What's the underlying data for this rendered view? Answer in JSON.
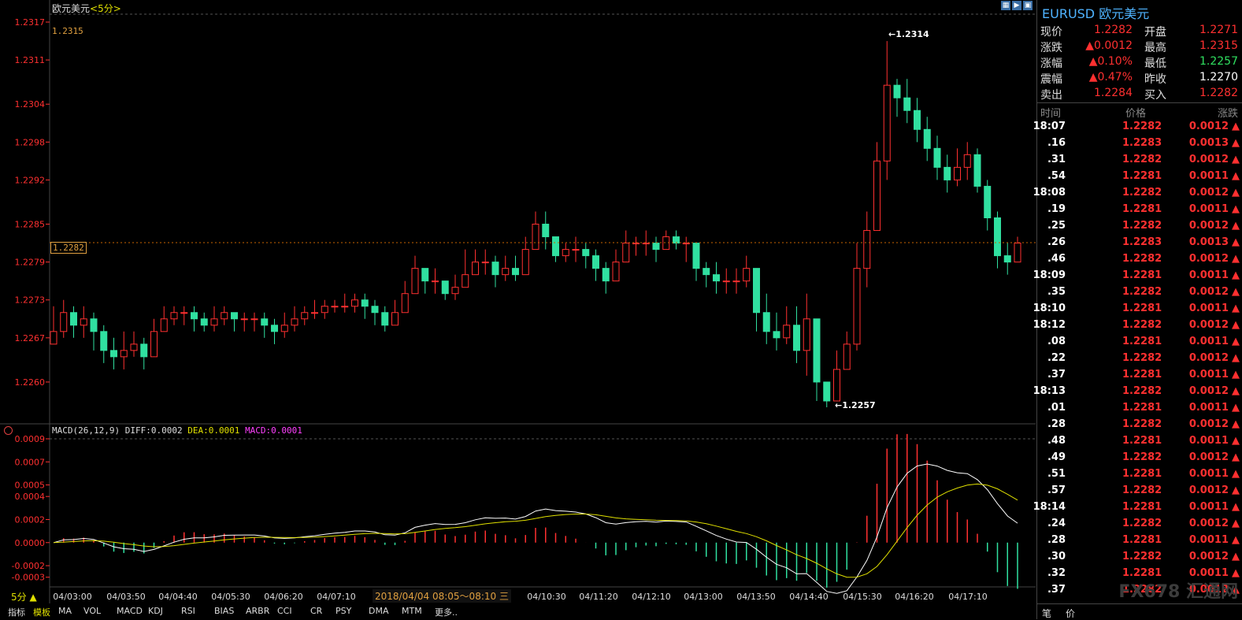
{
  "title": "欧元美元",
  "period_label": "<5分>",
  "top_value_label": "1.2315",
  "current_price_tag": "1.2282",
  "high_annotation": "1.2314",
  "low_annotation": "1.2257",
  "macd_label": "MACD(26,12,9)",
  "diff_label": "DIFF:0.0002",
  "dea_label": "DEA:0.0001",
  "macd_val_label": "MACD:0.0001",
  "time_popup": "2018/04/04 08:05～08:10 三",
  "period_button": "5分",
  "bottom_tabs": [
    "指标",
    "模板",
    "MA",
    "VOL",
    "MACD",
    "KDJ",
    "RSI",
    "BIAS",
    "ARBR",
    "CCI",
    "CR",
    "PSY",
    "DMA",
    "MTM",
    "更多.."
  ],
  "brand": "FX678 汇通网",
  "colors": {
    "up": "#ff3030",
    "down": "#30e0a0",
    "price_axis": "#ff3030",
    "diff": "#ffffff",
    "dea": "#e0e000",
    "macd": "#ff40ff"
  },
  "chart_data": {
    "type": "candlestick",
    "price_ticks": [
      "1.2317",
      "1.2311",
      "1.2304",
      "1.2298",
      "1.2292",
      "1.2285",
      "1.2279",
      "1.2273",
      "1.2267",
      "1.2260"
    ],
    "macd_ticks": [
      "0.0009",
      "0.0007",
      "0.0005",
      "0.0004",
      "0.0002",
      "0.0000",
      "-0.0002",
      "-0.0003"
    ],
    "x_ticks": [
      "04/03:00",
      "04/03:50",
      "04/04:40",
      "04/05:30",
      "04/06:20",
      "04/07:10",
      "04/10:30",
      "04/11:20",
      "04/12:10",
      "04/13:00",
      "04/13:50",
      "04/14:40",
      "04/15:30",
      "04/16:20",
      "04/17:10"
    ],
    "price_range": [
      1.2255,
      1.2318
    ],
    "macd_range": [
      -0.00035,
      0.0009
    ],
    "closes": [
      1.2268,
      1.2271,
      1.2269,
      1.227,
      1.2268,
      1.2265,
      1.2264,
      1.2265,
      1.2266,
      1.2264,
      1.2268,
      1.227,
      1.2271,
      1.2271,
      1.227,
      1.2269,
      1.227,
      1.2271,
      1.227,
      1.227,
      1.227,
      1.2269,
      1.2268,
      1.2269,
      1.227,
      1.2271,
      1.2271,
      1.2272,
      1.2272,
      1.2272,
      1.2273,
      1.2272,
      1.2271,
      1.2269,
      1.2271,
      1.2274,
      1.2278,
      1.2276,
      1.2276,
      1.2274,
      1.2275,
      1.2277,
      1.2279,
      1.2279,
      1.2277,
      1.2278,
      1.2277,
      1.2281,
      1.2285,
      1.2283,
      1.228,
      1.2281,
      1.2281,
      1.228,
      1.2278,
      1.2276,
      1.2279,
      1.2282,
      1.2282,
      1.2282,
      1.2281,
      1.2283,
      1.2282,
      1.2282,
      1.2278,
      1.2277,
      1.2276,
      1.2276,
      1.2276,
      1.2278,
      1.2271,
      1.2268,
      1.2267,
      1.2269,
      1.2265,
      1.227,
      1.226,
      1.2257,
      1.2262,
      1.2266,
      1.2278,
      1.2284,
      1.2295,
      1.2307,
      1.2305,
      1.2303,
      1.23,
      1.2297,
      1.2294,
      1.2292,
      1.2294,
      1.2296,
      1.2291,
      1.2286,
      1.228,
      1.2279,
      1.2282
    ],
    "highs": [
      1.2272,
      1.2273,
      1.2272,
      1.2272,
      1.2271,
      1.2269,
      1.2267,
      1.2268,
      1.2268,
      1.2267,
      1.227,
      1.2272,
      1.2272,
      1.2272,
      1.2272,
      1.2271,
      1.2272,
      1.2272,
      1.2271,
      1.2271,
      1.2271,
      1.2271,
      1.227,
      1.2271,
      1.2272,
      1.2272,
      1.2273,
      1.2273,
      1.2273,
      1.2274,
      1.2274,
      1.2274,
      1.2273,
      1.2272,
      1.2273,
      1.2276,
      1.228,
      1.2278,
      1.2278,
      1.2276,
      1.2277,
      1.2281,
      1.2281,
      1.2281,
      1.228,
      1.228,
      1.228,
      1.2283,
      1.2287,
      1.2287,
      1.2283,
      1.2282,
      1.2283,
      1.2282,
      1.2281,
      1.2279,
      1.2281,
      1.2284,
      1.2283,
      1.2284,
      1.2283,
      1.2284,
      1.2284,
      1.2283,
      1.2281,
      1.2279,
      1.2279,
      1.2278,
      1.2278,
      1.228,
      1.2277,
      1.2274,
      1.2271,
      1.2272,
      1.2272,
      1.2274,
      1.227,
      1.2259,
      1.2265,
      1.2268,
      1.2282,
      1.2287,
      1.2298,
      1.2314,
      1.2308,
      1.2308,
      1.2305,
      1.2302,
      1.2299,
      1.2296,
      1.2297,
      1.2298,
      1.2297,
      1.2292,
      1.2287,
      1.2282,
      1.2283
    ],
    "lows": [
      1.2266,
      1.2267,
      1.2267,
      1.2267,
      1.2265,
      1.2263,
      1.2262,
      1.2262,
      1.2264,
      1.2262,
      1.2264,
      1.2268,
      1.2269,
      1.2269,
      1.2268,
      1.2268,
      1.2268,
      1.2269,
      1.2268,
      1.2268,
      1.2268,
      1.2267,
      1.2266,
      1.2267,
      1.2268,
      1.2269,
      1.227,
      1.227,
      1.2271,
      1.2271,
      1.2271,
      1.227,
      1.2269,
      1.2268,
      1.2269,
      1.2271,
      1.2274,
      1.2274,
      1.2274,
      1.2273,
      1.2273,
      1.2275,
      1.2277,
      1.2277,
      1.2275,
      1.2276,
      1.2276,
      1.2278,
      1.2281,
      1.2281,
      1.2279,
      1.2279,
      1.2279,
      1.2278,
      1.2276,
      1.2274,
      1.2276,
      1.2279,
      1.228,
      1.228,
      1.2279,
      1.2281,
      1.2281,
      1.2279,
      1.2276,
      1.2275,
      1.2274,
      1.2274,
      1.2274,
      1.2275,
      1.2268,
      1.2266,
      1.2265,
      1.2266,
      1.2263,
      1.2261,
      1.2257,
      1.2256,
      1.2257,
      1.2262,
      1.2265,
      1.2275,
      1.2284,
      1.2292,
      1.2302,
      1.2301,
      1.2298,
      1.2295,
      1.2292,
      1.229,
      1.2291,
      1.2292,
      1.229,
      1.2284,
      1.2278,
      1.2277,
      1.2279
    ],
    "opens_prev_close": true
  },
  "quote": {
    "symbol": "EURUSD",
    "name": "欧元美元",
    "rows": [
      {
        "l1": "现价",
        "v1": "1.2282",
        "c1": "red",
        "l2": "开盘",
        "v2": "1.2271",
        "c2": "red"
      },
      {
        "l1": "涨跌",
        "v1": "0.0012",
        "c1": "red",
        "a1": "▲",
        "l2": "最高",
        "v2": "1.2315",
        "c2": "red"
      },
      {
        "l1": "涨幅",
        "v1": "0.10%",
        "c1": "red",
        "a1": "▲",
        "l2": "最低",
        "v2": "1.2257",
        "c2": "green"
      },
      {
        "l1": "震幅",
        "v1": "0.47%",
        "c1": "red",
        "a1": "▲",
        "l2": "昨收",
        "v2": "1.2270",
        "c2": "white"
      },
      {
        "l1": "卖出",
        "v1": "1.2284",
        "c1": "red",
        "l2": "买入",
        "v2": "1.2282",
        "c2": "red"
      }
    ]
  },
  "ticks_header": {
    "time": "时间",
    "price": "价格",
    "change": "涨跌"
  },
  "ticks": [
    {
      "t": "18:07",
      "p": "1.2282",
      "c": "0.0012"
    },
    {
      "t": ".16",
      "p": "1.2283",
      "c": "0.0013"
    },
    {
      "t": ".31",
      "p": "1.2282",
      "c": "0.0012"
    },
    {
      "t": ".54",
      "p": "1.2281",
      "c": "0.0011"
    },
    {
      "t": "18:08",
      "p": "1.2282",
      "c": "0.0012"
    },
    {
      "t": ".19",
      "p": "1.2281",
      "c": "0.0011"
    },
    {
      "t": ".25",
      "p": "1.2282",
      "c": "0.0012"
    },
    {
      "t": ".26",
      "p": "1.2283",
      "c": "0.0013"
    },
    {
      "t": ".46",
      "p": "1.2282",
      "c": "0.0012"
    },
    {
      "t": "18:09",
      "p": "1.2281",
      "c": "0.0011"
    },
    {
      "t": ".35",
      "p": "1.2282",
      "c": "0.0012"
    },
    {
      "t": "18:10",
      "p": "1.2281",
      "c": "0.0011"
    },
    {
      "t": "18:12",
      "p": "1.2282",
      "c": "0.0012"
    },
    {
      "t": ".08",
      "p": "1.2281",
      "c": "0.0011"
    },
    {
      "t": ".22",
      "p": "1.2282",
      "c": "0.0012"
    },
    {
      "t": ".37",
      "p": "1.2281",
      "c": "0.0011"
    },
    {
      "t": "18:13",
      "p": "1.2282",
      "c": "0.0012"
    },
    {
      "t": ".01",
      "p": "1.2281",
      "c": "0.0011"
    },
    {
      "t": ".28",
      "p": "1.2282",
      "c": "0.0012"
    },
    {
      "t": ".48",
      "p": "1.2281",
      "c": "0.0011"
    },
    {
      "t": ".49",
      "p": "1.2282",
      "c": "0.0012"
    },
    {
      "t": ".51",
      "p": "1.2281",
      "c": "0.0011"
    },
    {
      "t": ".57",
      "p": "1.2282",
      "c": "0.0012"
    },
    {
      "t": "18:14",
      "p": "1.2281",
      "c": "0.0011"
    },
    {
      "t": ".24",
      "p": "1.2282",
      "c": "0.0012"
    },
    {
      "t": ".28",
      "p": "1.2281",
      "c": "0.0011"
    },
    {
      "t": ".30",
      "p": "1.2282",
      "c": "0.0012"
    },
    {
      "t": ".32",
      "p": "1.2281",
      "c": "0.0011"
    },
    {
      "t": ".37",
      "p": "1.2282",
      "c": "0.0012"
    }
  ],
  "footer_tabs": [
    "笔",
    "价"
  ]
}
